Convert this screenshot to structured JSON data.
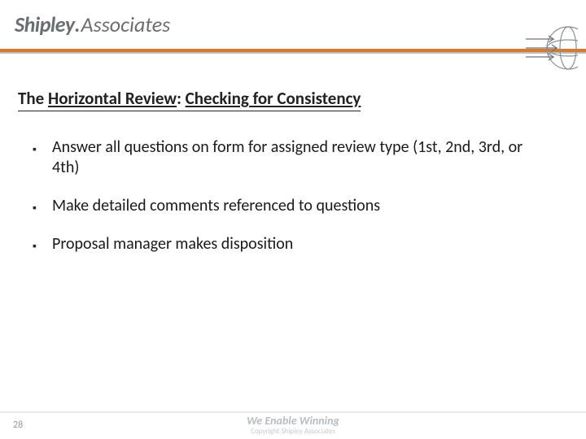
{
  "header": {
    "logo_primary": "Shipley",
    "logo_dot": ".",
    "logo_secondary": "Associates"
  },
  "title": {
    "prefix": "The ",
    "underlined1": "Horizontal Review",
    "sep": ": ",
    "underlined2": "Checking for Consistency"
  },
  "bullets": [
    "Answer all questions on form for assigned review type (1st, 2nd, 3rd, or 4th)",
    "Make detailed comments referenced to questions",
    "Proposal manager makes disposition"
  ],
  "footer": {
    "page_number": "28",
    "tagline": "We Enable Winning",
    "copyright": "Copyright Shipley Associates"
  }
}
